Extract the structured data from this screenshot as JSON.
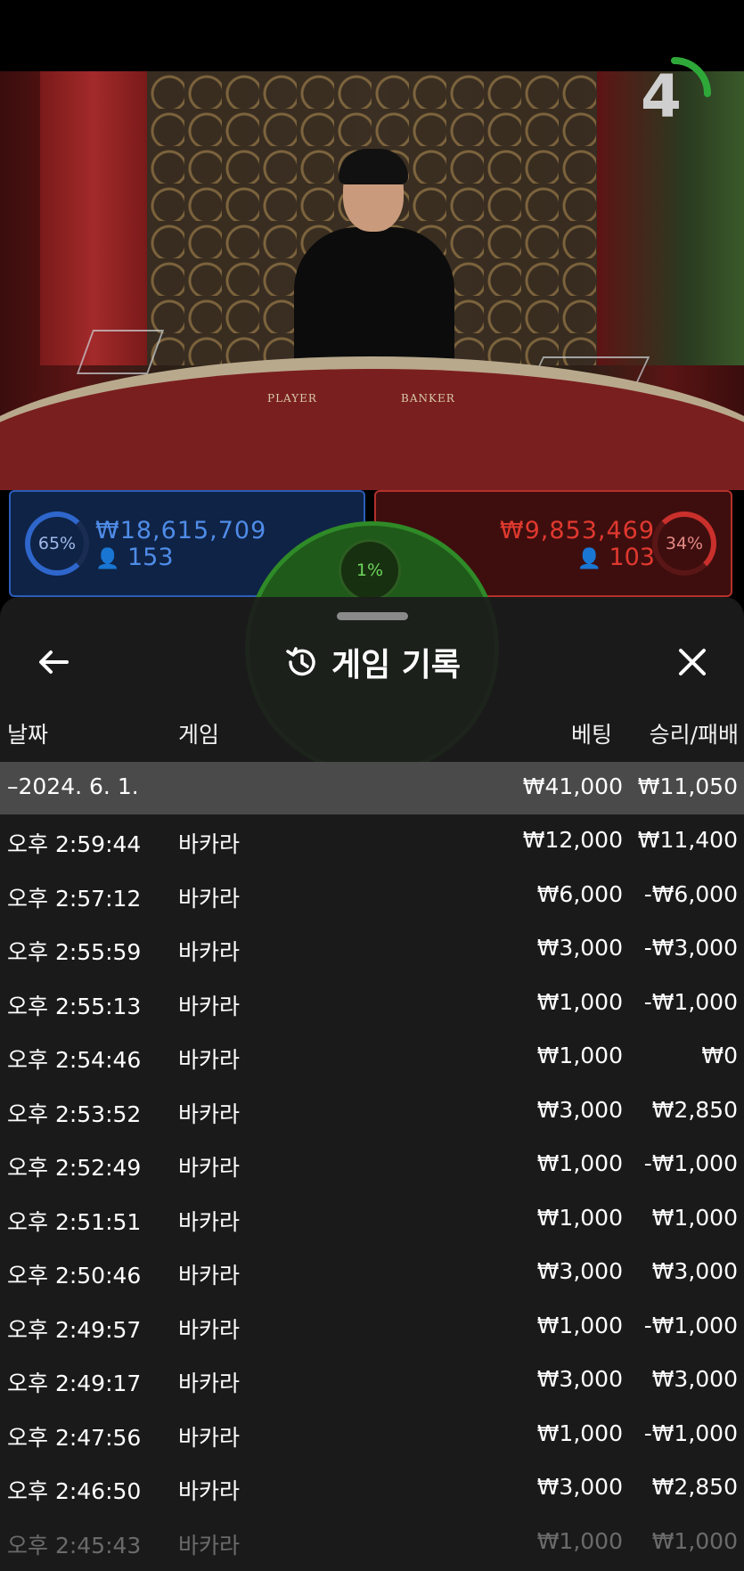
{
  "live": {
    "countdown": "4",
    "table_labels": {
      "player": "PLAYER",
      "banker": "BANKER"
    }
  },
  "betting": {
    "player": {
      "percent": "65%",
      "amount": "₩18,615,709",
      "players": "153",
      "color": "#2b5db8"
    },
    "tie": {
      "percent": "1%",
      "color": "#2f8a28"
    },
    "banker": {
      "percent": "34%",
      "amount": "₩9,853,469",
      "players": "103",
      "color": "#b3312c"
    }
  },
  "history": {
    "title": "게임 기록",
    "icons": {
      "back": "arrow-left-icon",
      "title": "history-clock-icon",
      "close": "close-x-icon"
    },
    "columns": {
      "date": "날짜",
      "game": "게임",
      "bet": "베팅",
      "result": "승리/패배"
    },
    "date_group": {
      "label": "–2024. 6. 1.",
      "bet": "₩41,000",
      "result": "₩11,050"
    },
    "rows": [
      {
        "time": "오후 2:59:44",
        "game": "바카라",
        "bet": "₩12,000",
        "result": "₩11,400"
      },
      {
        "time": "오후 2:57:12",
        "game": "바카라",
        "bet": "₩6,000",
        "result": "-₩6,000"
      },
      {
        "time": "오후 2:55:59",
        "game": "바카라",
        "bet": "₩3,000",
        "result": "-₩3,000"
      },
      {
        "time": "오후 2:55:13",
        "game": "바카라",
        "bet": "₩1,000",
        "result": "-₩1,000"
      },
      {
        "time": "오후 2:54:46",
        "game": "바카라",
        "bet": "₩1,000",
        "result": "₩0"
      },
      {
        "time": "오후 2:53:52",
        "game": "바카라",
        "bet": "₩3,000",
        "result": "₩2,850"
      },
      {
        "time": "오후 2:52:49",
        "game": "바카라",
        "bet": "₩1,000",
        "result": "-₩1,000"
      },
      {
        "time": "오후 2:51:51",
        "game": "바카라",
        "bet": "₩1,000",
        "result": "₩1,000"
      },
      {
        "time": "오후 2:50:46",
        "game": "바카라",
        "bet": "₩3,000",
        "result": "₩3,000"
      },
      {
        "time": "오후 2:49:57",
        "game": "바카라",
        "bet": "₩1,000",
        "result": "-₩1,000"
      },
      {
        "time": "오후 2:49:17",
        "game": "바카라",
        "bet": "₩3,000",
        "result": "₩3,000"
      },
      {
        "time": "오후 2:47:56",
        "game": "바카라",
        "bet": "₩1,000",
        "result": "-₩1,000"
      },
      {
        "time": "오후 2:46:50",
        "game": "바카라",
        "bet": "₩3,000",
        "result": "₩2,850"
      },
      {
        "time": "오후 2:45:43",
        "game": "바카라",
        "bet": "₩1,000",
        "result": "₩1,000"
      }
    ]
  }
}
